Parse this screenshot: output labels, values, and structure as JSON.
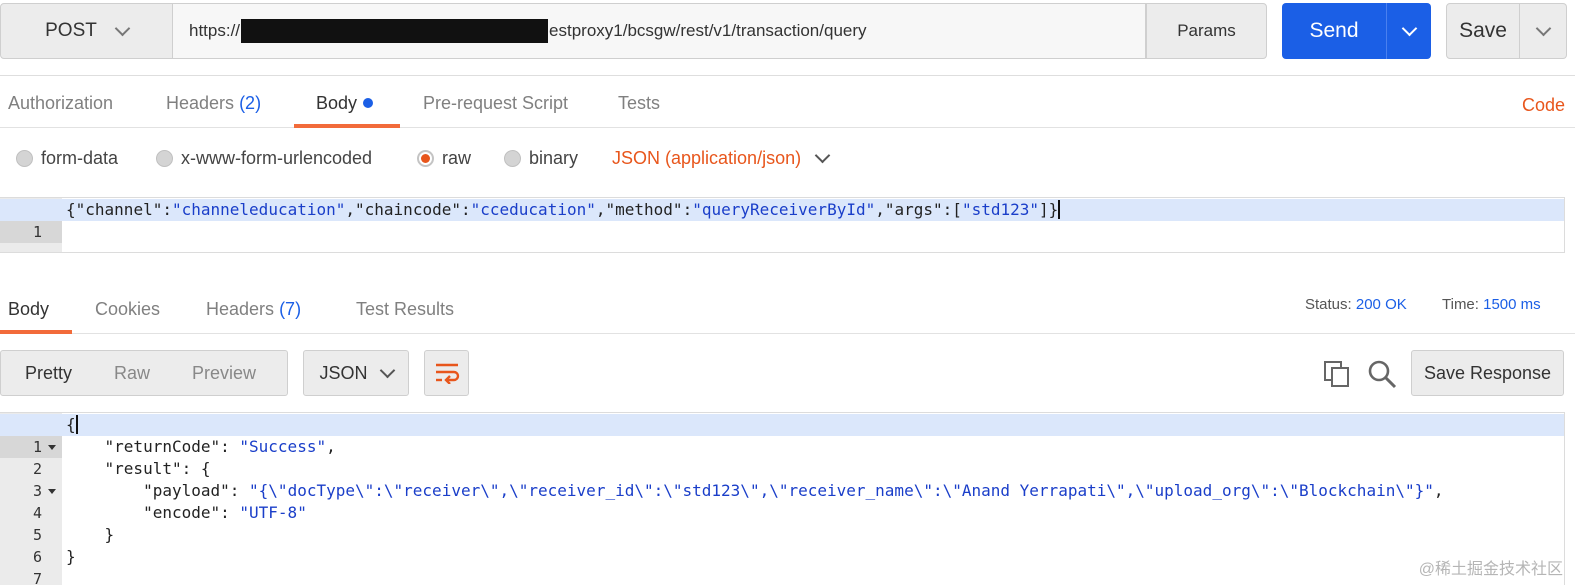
{
  "request": {
    "method": "POST",
    "url_prefix": "https://",
    "url_suffix": "estproxy1/bcsgw/rest/v1/transaction/query",
    "params_label": "Params",
    "send_label": "Send",
    "save_label": "Save"
  },
  "request_tabs": {
    "authorization": "Authorization",
    "headers": "Headers",
    "headers_count": "(2)",
    "body": "Body",
    "pre_request": "Pre-request Script",
    "tests": "Tests",
    "code": "Code"
  },
  "body_types": {
    "form_data": "form-data",
    "urlencoded": "x-www-form-urlencoded",
    "raw": "raw",
    "binary": "binary",
    "content_type": "JSON (application/json)"
  },
  "request_body": {
    "line_number": "1",
    "open": "{",
    "k_channel": "\"channel\"",
    "v_channel": "\"channeleducation\"",
    "k_chaincode": "\"chaincode\"",
    "v_chaincode": "\"cceducation\"",
    "k_method": "\"method\"",
    "v_method": "\"queryReceiverById\"",
    "k_args": "\"args\"",
    "v_args": "\"std123\"",
    "close": "]}"
  },
  "response_tabs": {
    "body": "Body",
    "cookies": "Cookies",
    "headers": "Headers",
    "headers_count": "(7)",
    "test_results": "Test Results",
    "status_label": "Status:",
    "status_value": "200 OK",
    "time_label": "Time:",
    "time_value": "1500 ms"
  },
  "response_toolbar": {
    "pretty": "Pretty",
    "raw": "Raw",
    "preview": "Preview",
    "format": "JSON",
    "save_response": "Save Response"
  },
  "response_body": {
    "line_numbers": [
      "1",
      "2",
      "3",
      "4",
      "5",
      "6",
      "7"
    ],
    "open": "{",
    "k_returnCode": "\"returnCode\"",
    "v_returnCode": "\"Success\"",
    "k_result": "\"result\"",
    "k_payload": "\"payload\"",
    "v_payload": "\"{\\\"docType\\\":\\\"receiver\\\",\\\"receiver_id\\\":\\\"std123\\\",\\\"receiver_name\\\":\\\"Anand Yerrapati\\\",\\\"upload_org\\\":\\\"Blockchain\\\"}\"",
    "k_encode": "\"encode\"",
    "v_encode": "\"UTF-8\"",
    "inner_close": "}",
    "close": "}"
  },
  "watermark": "@稀土掘金技术社区",
  "colors": {
    "accent_blue": "#1b5fe6",
    "accent_orange": "#e8561c",
    "string_blue": "#1a3ec9",
    "line_highlight": "#dbe7fb"
  }
}
